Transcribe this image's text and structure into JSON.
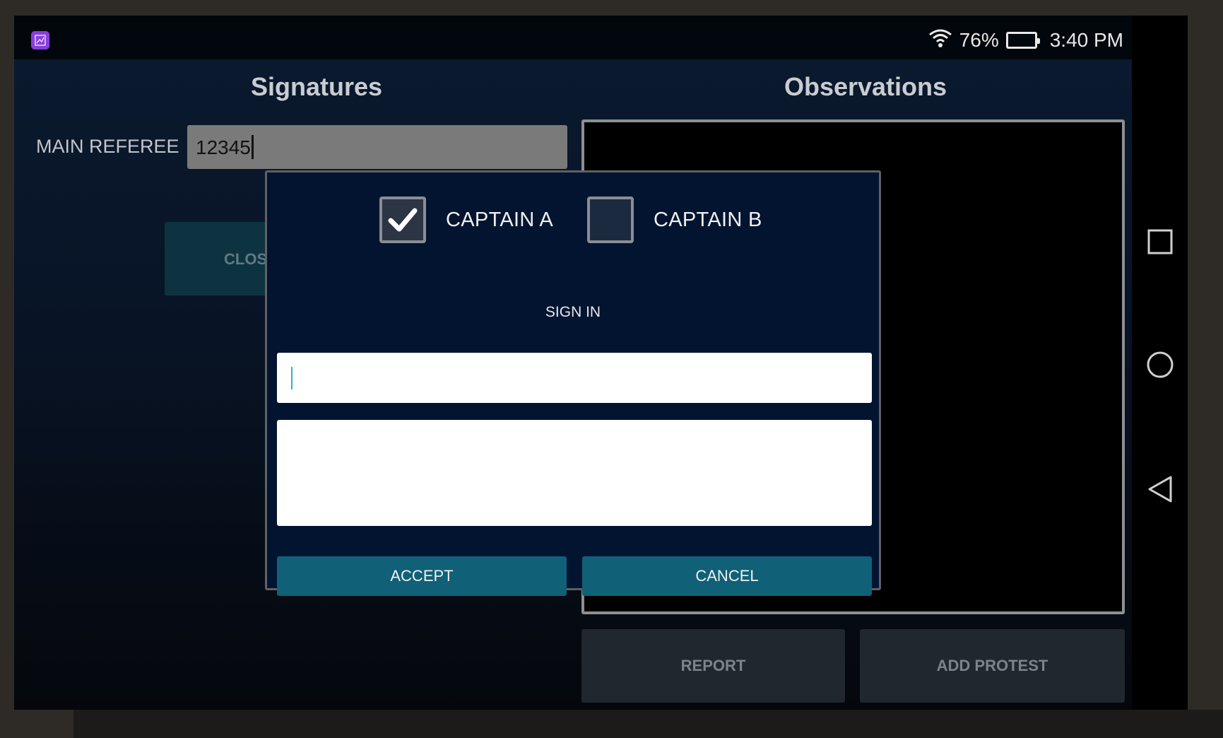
{
  "status_bar": {
    "battery_percent": "76%",
    "battery_level": 0.76,
    "time": "3:40 PM",
    "icons": [
      "app-icon",
      "wifi-icon",
      "battery-icon"
    ]
  },
  "page": {
    "signatures_title": "Signatures",
    "observations_title": "Observations",
    "main_referee_label": "MAIN REFEREE",
    "main_referee_value": "12345",
    "close_button_visible_text": "CLOS",
    "observations_text": "",
    "report_button": "REPORT",
    "add_protest_button": "ADD PROTEST"
  },
  "dialog": {
    "captain_a": {
      "label": "CAPTAIN A",
      "checked": true
    },
    "captain_b": {
      "label": "CAPTAIN B",
      "checked": false
    },
    "sign_in_label": "SIGN IN",
    "sign_input_value": "",
    "accept_button": "ACCEPT",
    "cancel_button": "CANCEL"
  },
  "nav_bar": {
    "icons": [
      "recents-square-icon",
      "home-circle-icon",
      "back-triangle-icon"
    ]
  },
  "colors": {
    "dialog_bg": "#031430",
    "button_teal": "#106077",
    "app_icon_purple": "#8a3ddc"
  }
}
